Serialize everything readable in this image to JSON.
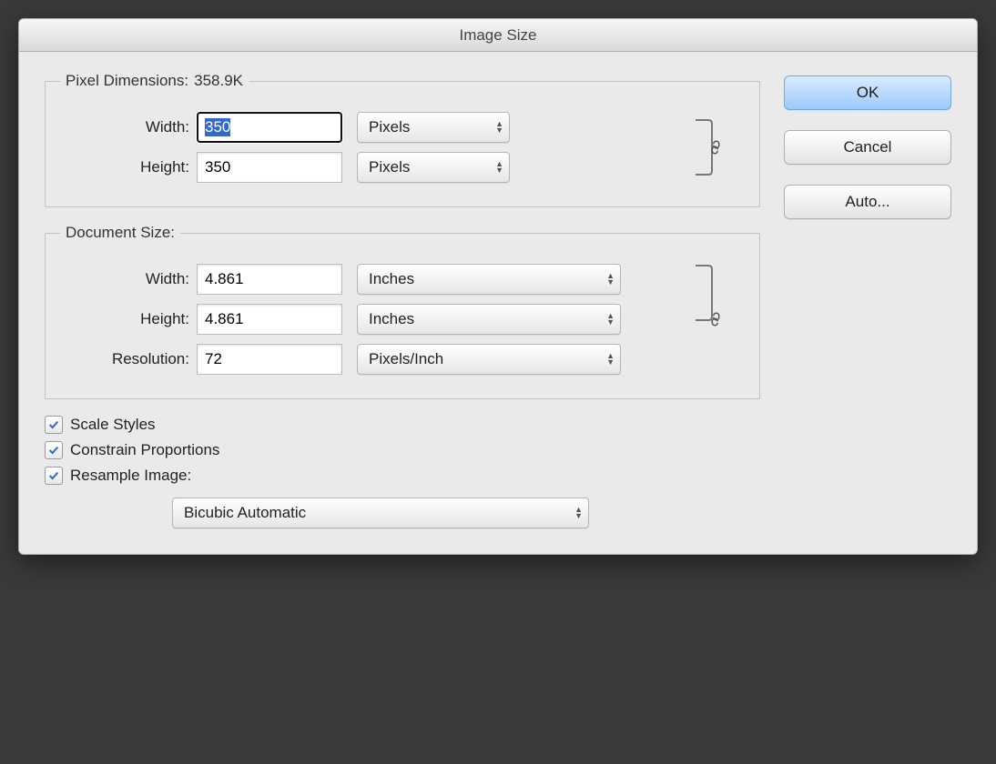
{
  "dialog": {
    "title": "Image Size"
  },
  "pixel_dimensions": {
    "legend_prefix": "Pixel Dimensions:",
    "size_text": "358.9K",
    "width_label": "Width:",
    "width_value": "350",
    "width_unit": "Pixels",
    "height_label": "Height:",
    "height_value": "350",
    "height_unit": "Pixels"
  },
  "document_size": {
    "legend": "Document Size:",
    "width_label": "Width:",
    "width_value": "4.861",
    "width_unit": "Inches",
    "height_label": "Height:",
    "height_value": "4.861",
    "height_unit": "Inches",
    "resolution_label": "Resolution:",
    "resolution_value": "72",
    "resolution_unit": "Pixels/Inch"
  },
  "options": {
    "scale_styles": {
      "label": "Scale Styles",
      "checked": true
    },
    "constrain_proportions": {
      "label": "Constrain Proportions",
      "checked": true
    },
    "resample_image": {
      "label": "Resample Image:",
      "checked": true
    },
    "resample_method": "Bicubic Automatic"
  },
  "buttons": {
    "ok": "OK",
    "cancel": "Cancel",
    "auto": "Auto..."
  }
}
